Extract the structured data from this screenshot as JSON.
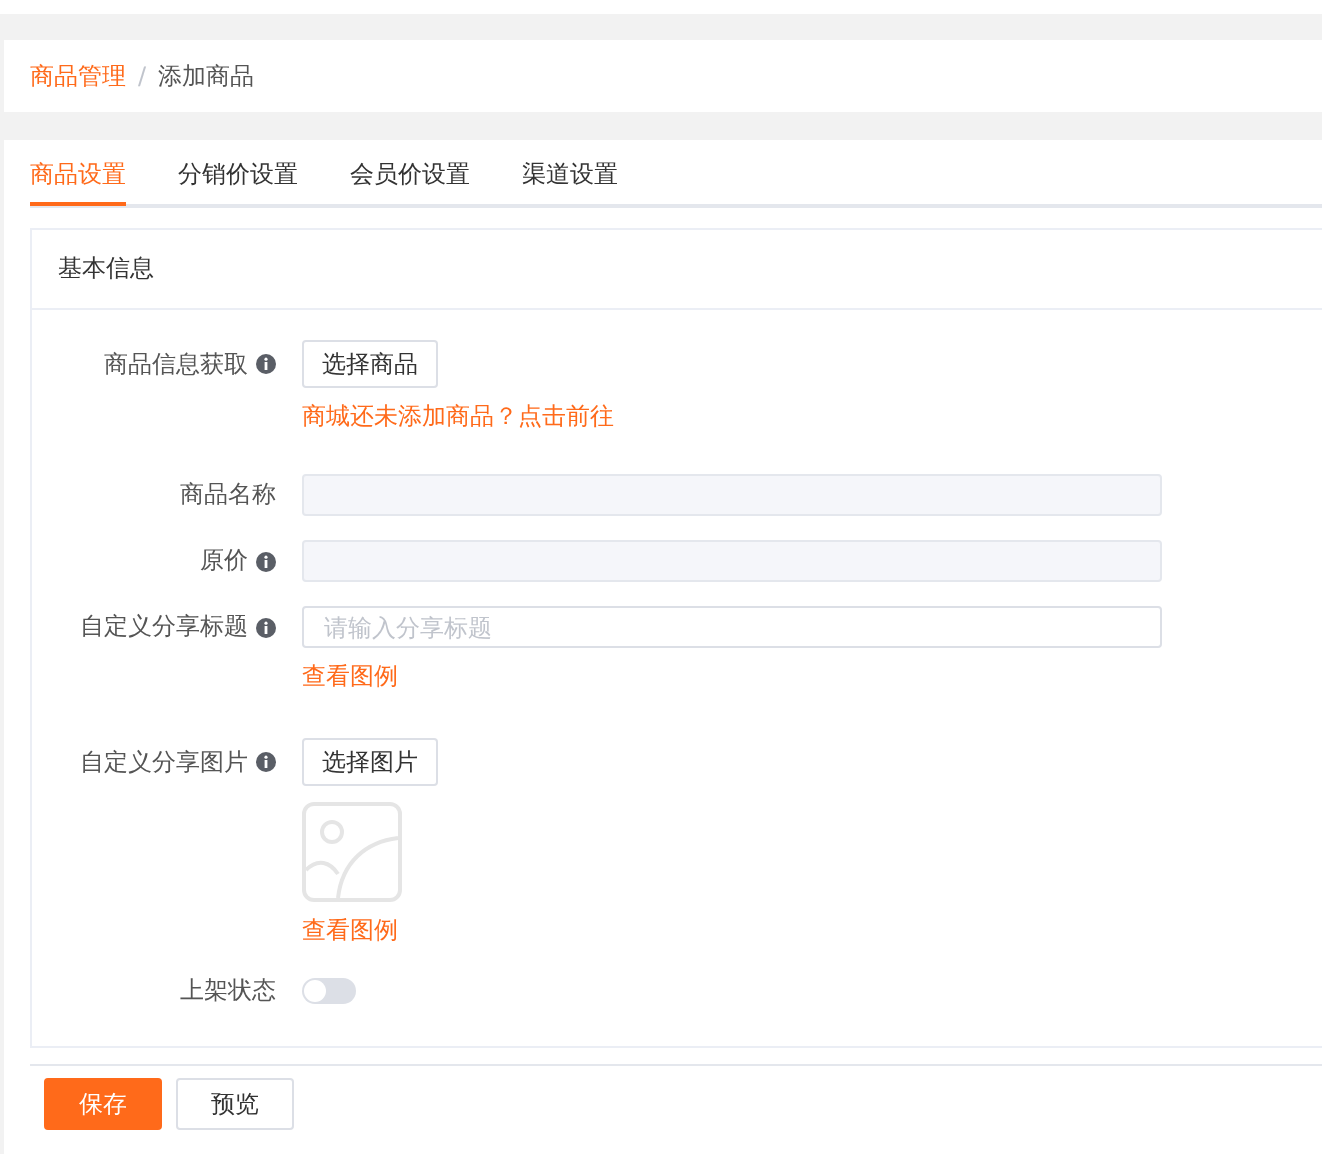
{
  "breadcrumb": [
    {
      "label": "商品管理",
      "link": true
    },
    {
      "label": "添加商品",
      "link": false
    }
  ],
  "breadcrumb_separator": "/",
  "tabs": [
    {
      "label": "商品设置",
      "selected": true
    },
    {
      "label": "分销价设置",
      "selected": false
    },
    {
      "label": "会员价设置",
      "selected": false
    },
    {
      "label": "渠道设置",
      "selected": false
    }
  ],
  "section": {
    "title": "基本信息"
  },
  "fields": [
    {
      "kind": "button",
      "label": "商品信息获取",
      "info": true,
      "button": "选择商品",
      "note": "商城还未添加商品？点击前往"
    },
    {
      "kind": "readonly_input",
      "label": "商品名称",
      "info": false
    },
    {
      "kind": "readonly_input",
      "label": "原价",
      "info": true
    },
    {
      "kind": "input",
      "label": "自定义分享标题",
      "info": true,
      "placeholder": "请输入分享标题",
      "link": "查看图例"
    },
    {
      "kind": "image",
      "label": "自定义分享图片",
      "info": true,
      "button": "选择图片",
      "link": "查看图例"
    },
    {
      "kind": "switch",
      "label": "上架状态",
      "info": false,
      "on": false
    }
  ],
  "footer_buttons": [
    {
      "label": "保存",
      "primary": true
    },
    {
      "label": "预览",
      "primary": false
    }
  ]
}
